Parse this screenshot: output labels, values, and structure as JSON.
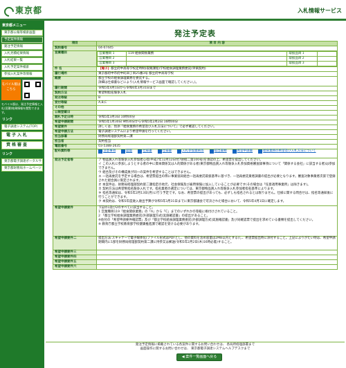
{
  "header": {
    "logo_text": "東京都",
    "service_name": "入札情報サービス"
  },
  "sidebar": {
    "menu_title": "東京都メニュー",
    "items": [
      "東京都公報等検索画面",
      "予定案件情報",
      "発注予定情報",
      "入札見積結果情報",
      "入札結果一覧",
      "入札予定案件検索",
      "参加入札案件等情報"
    ],
    "mobile": {
      "button": "モバイル版はこちら",
      "note": "モバイル版は、発注予定情報と入札(見積)結果情報を閲覧できます。"
    },
    "links_title": "リンク",
    "links": [
      "電子調達システム(TOP)"
    ],
    "big_buttons": [
      "電子入札",
      "資格審査"
    ],
    "link2_title": "リンク",
    "links2": [
      "東京都電子調達ポータルサイト",
      "東京都財務局ホームページ"
    ]
  },
  "main": {
    "title": "発注予定表",
    "col_item": "項目",
    "col_content": "項 目 内 容",
    "rows": [
      {
        "label": "契約番号",
        "value": "04-07445"
      },
      {
        "label": "営業種目",
        "cells": [
          [
            "営業種目 1",
            "119 給食関係業務",
            "取扱品目 1",
            ""
          ],
          [
            "営業種目 2",
            "",
            "取扱品目 2",
            ""
          ],
          [
            "営業種目 3",
            "",
            "取扱品目 3",
            ""
          ]
        ]
      },
      {
        "label": "件 名",
        "tag": "【電子】",
        "value": "都立府中高等学校定時制(夜間課程)学校給食調理業務委託(単価契約)"
      },
      {
        "label": "履行場所",
        "value": "東京都府中市府中町四丁目25番3号 都立府中高等学校"
      },
      {
        "label": "概要",
        "value": "都立学校の給食調理業務を委託する。\n詳細は仕様書などにより(入札情報サービス画面で確認してください。)。"
      },
      {
        "label": "履行期間",
        "value": "令和5年4月1日から令和6年3月31日まで"
      },
      {
        "label": "契約方法",
        "value": "希望制指名競争入札"
      },
      {
        "label": "発注等級",
        "value": "B"
      },
      {
        "label": "受付等級",
        "value": "A,B,C"
      },
      {
        "label": "その他",
        "value": ""
      },
      {
        "label": "公報登載日",
        "value": ""
      },
      {
        "label": "開札予定日時",
        "value": "令和5年3月3日 10時00分"
      },
      {
        "label": "希望申請期間",
        "value": "令和5年1月30日 9時30分から令和5年2月2日 16時00分"
      },
      {
        "label": "希望要件",
        "value": "詳しくは、別添「給食業務の希望及び入札方法について」で必ず確認してください。"
      },
      {
        "label": "希望申請方法",
        "value": "電子調達システムにより希望申請を行ってください。"
      },
      {
        "label": "担当部署",
        "value": "財務局経理部契約第二課"
      },
      {
        "label": "担当者",
        "value": "契約担当"
      },
      {
        "label": "電話番号",
        "value": "03-5388-2635"
      },
      {
        "label": "配布資料等",
        "files": [
          "注意事項",
          "図面",
          "仕様書",
          "仕様書",
          "入札参加資格等",
          "提出書類",
          "希望申請書",
          "給食業務の希望及び入札方法について"
        ]
      },
      {
        "label": "発注予定者等",
        "value": "ア 物品買入れ等競争入札参加者心得(平成7年12月12日付7財経二第100号)を承認の上、希望票を提出してください。\nイ この入札に参加しようとする者の中に資本関係又は人的関係がある者(東京都物品買入れ等競争入札参加資格審査録事項について「関係する会社」に該当する者)は参加できません。\nウ 組合及びその構成員が同一の案件を希望することはできません。\nエ 一括再委託を予定する場合は、希望票提出の際に事業協同組合一括再委託取扱基準に基づき、一括再委託業者調書の提出が必要となります。審査対象事業者次第で登録された組合員に限定されます。\nオ 本案件は、財務局経理部契約第二課指定の地元、社会保険及び雇用保険に加入していることが必要です(その場合は「任意適用事業所」は除きます)。\nカ 契約方法は希望制指名競争入札です。指名業者の選定については、東京都物品買入れ等競争入札参加者指名基準によります。\nキ 指名等通知は、令和5年2月13日(月)に行う予定です。なお、希望票の提出があっても、必ずしも指名されるとは限りません。仕様に関する問合せは、指名等通知後に行うことができます。\nク 本契約は、令和5年度歳入歳出予算が令和5年3月31日までに東京都議会で可決された場合において、令和5年4月1日に確定します。"
      },
      {
        "label": "希望申請要件",
        "value": "下記の1及び2のすべてに該当すること。\n1 営業種目119「給食関係業務」の「A」から「C」までのいずれかの等級に格付けされていること。\n2 「都立学校給食調理業務委託(外部調理方式)実施確認書」の提出があること。\n※佐付の「希望申請要件確認票」及び「都立学校給食調理業務委託(外部調理方式)実施確認書」及び同確認票で提出を求めている書類を提出してください。\n※ 教育庁都立学校教育部学校健康推進課で確認を受ける必要があります。"
      },
      {
        "label": "希望申請要件二",
        "value": "提出方法:スキャナーで電子媒体化(ファイル形式はPDFとし、他の資料を含め容量は2MB以内とする)し、希望票提出時に添付すること。上記によりがたい時は、希望申請期間内に1部を財務局経理部契約第二課に持参又は郵送(令和5年2月2日(木)16時必着)すること。"
      },
      {
        "label": "希望申請要件三",
        "value": ""
      },
      {
        "label": "希望申請要件四",
        "value": ""
      },
      {
        "label": "希望申請要件五",
        "value": ""
      },
      {
        "label": "希望申請要件六",
        "value": ""
      }
    ],
    "back_button": "案件一覧画面へ戻る"
  },
  "footer": {
    "line1": "発注予定情報に掲載されている各案件に関するお問い合わせは、 各局所経理部署まで",
    "line2": "画面操作に関するお問い合わせは、 東京都電子調達システムヘルプデスクまで"
  }
}
